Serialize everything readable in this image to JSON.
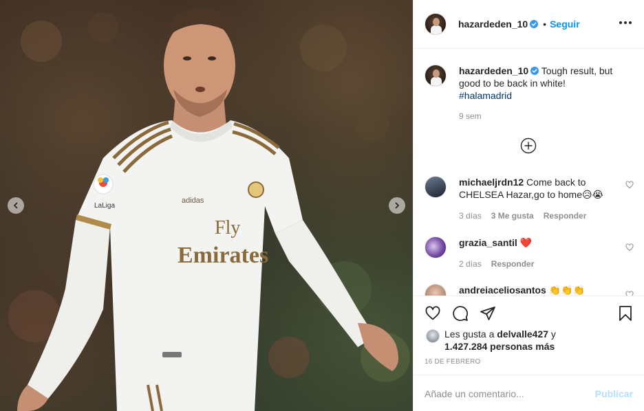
{
  "post": {
    "author": "hazardeden_10",
    "separator": "•",
    "follow_label": "Seguir",
    "caption": {
      "username": "hazardeden_10",
      "text": " Tough result, but good to be back in white!",
      "hashtag": "#halamadrid",
      "time": "9 sem"
    },
    "photo": {
      "sleeve_patch": "LaLiga",
      "brand": "adidas",
      "sponsor_line1": "Fly",
      "sponsor_line2": "Emirates"
    }
  },
  "comments": [
    {
      "username": "michaeljrdn12",
      "text": " Come back to CHELSEA Hazar,go to home😥😭",
      "time": "3 días",
      "likes": "3 Me gusta",
      "reply": "Responder"
    },
    {
      "username": "grazia_santil",
      "text": " ❤️",
      "time": "2 días",
      "reply": "Responder"
    },
    {
      "username": "andreiaceliosantos",
      "text": " 👏👏👏"
    }
  ],
  "likes": {
    "prefix": "Les gusta a ",
    "first_user": "delvalle427",
    "conj": " y",
    "others": "1.427.284 personas más"
  },
  "date": "16 DE FEBRERO",
  "composer": {
    "placeholder": "Añade un comentario...",
    "publish_label": "Publicar"
  },
  "colors": {
    "accent": "#0095f6",
    "publish_disabled": "#b2dffc",
    "hashtag": "#00376b",
    "heart": "#ed4956"
  },
  "icons": [
    "chevron-left-icon",
    "chevron-right-icon",
    "verified-icon",
    "more-options-icon",
    "add-circle-icon",
    "heart-icon",
    "comment-icon",
    "share-icon",
    "bookmark-icon"
  ]
}
